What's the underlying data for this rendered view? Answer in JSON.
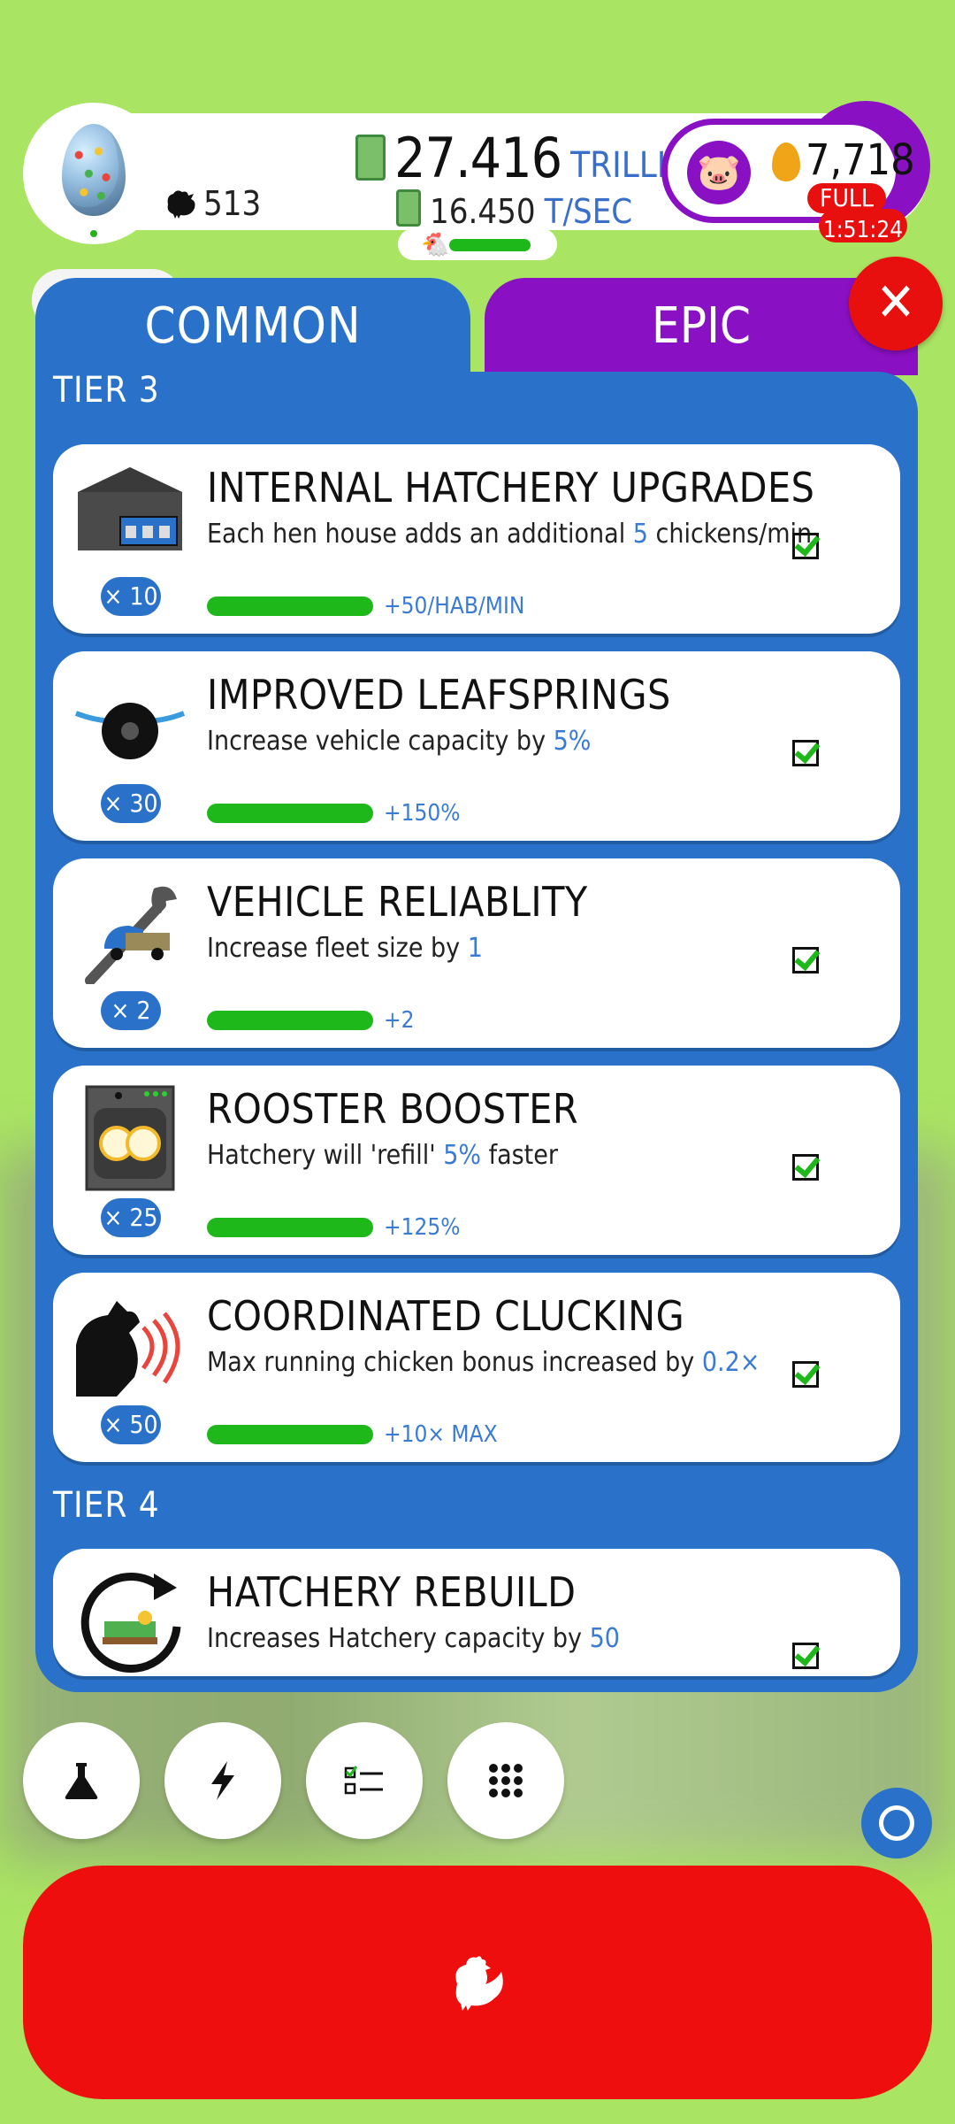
{
  "header": {
    "chicken_count": "513",
    "cash_value": "27.416",
    "cash_unit": "TRILLION",
    "rate_value": "16.450",
    "rate_unit": "T/SEC",
    "golden_eggs": "7,718",
    "piggy_status": "FULL",
    "timer": "1:51:24"
  },
  "tabs": [
    {
      "label": "COMMON",
      "active": true
    },
    {
      "label": "EPIC",
      "active": false
    }
  ],
  "tiers": [
    {
      "label": "TIER 3"
    },
    {
      "label": "TIER 4"
    }
  ],
  "research": [
    {
      "title": "INTERNAL HATCHERY UPGRADES",
      "desc_pre": "Each hen house adds an additional ",
      "desc_val": "5",
      "desc_post": " chickens/min",
      "count": "× 10",
      "gain": "+50/HAB/MIN",
      "icon": "hen-house-icon",
      "completed": true
    },
    {
      "title": "IMPROVED LEAFSPRINGS",
      "desc_pre": "Increase vehicle capacity by ",
      "desc_val": "5%",
      "desc_post": "",
      "count": "× 30",
      "gain": "+150%",
      "icon": "wheel-spring-icon",
      "completed": true
    },
    {
      "title": "VEHICLE RELIABLITY",
      "desc_pre": "Increase fleet size by ",
      "desc_val": "1",
      "desc_post": "",
      "count": "× 2",
      "gain": "+2",
      "icon": "wrench-truck-icon",
      "completed": true
    },
    {
      "title": "ROOSTER BOOSTER",
      "desc_pre": "Hatchery will 'refill' ",
      "desc_val": "5%",
      "desc_post": " faster",
      "count": "× 25",
      "gain": "+125%",
      "icon": "incubator-icon",
      "completed": true
    },
    {
      "title": "COORDINATED CLUCKING",
      "desc_pre": "Max running chicken bonus increased by ",
      "desc_val": "0.2×",
      "desc_post": "",
      "count": "× 50",
      "gain": "+10× MAX",
      "icon": "clucking-chicken-icon",
      "completed": true
    },
    {
      "title": "HATCHERY REBUILD",
      "desc_pre": "Increases Hatchery capacity by ",
      "desc_val": "50",
      "desc_post": "",
      "count": "",
      "gain": "",
      "icon": "rebuild-bed-icon",
      "completed": true
    }
  ],
  "research_progress": [
    1,
    1,
    1,
    1,
    1
  ],
  "toolbar": {
    "buttons": [
      "research-flask-icon",
      "boost-lightning-icon",
      "missions-checklist-icon",
      "menu-grid-icon"
    ]
  },
  "colors": {
    "background": "#a9e462",
    "panel_blue": "#2a72c9",
    "epic_purple": "#8a10c4",
    "hatch_red": "#ef0e0e",
    "progress_green": "#1fb81a",
    "highlight_blue": "#3a7bd5"
  }
}
